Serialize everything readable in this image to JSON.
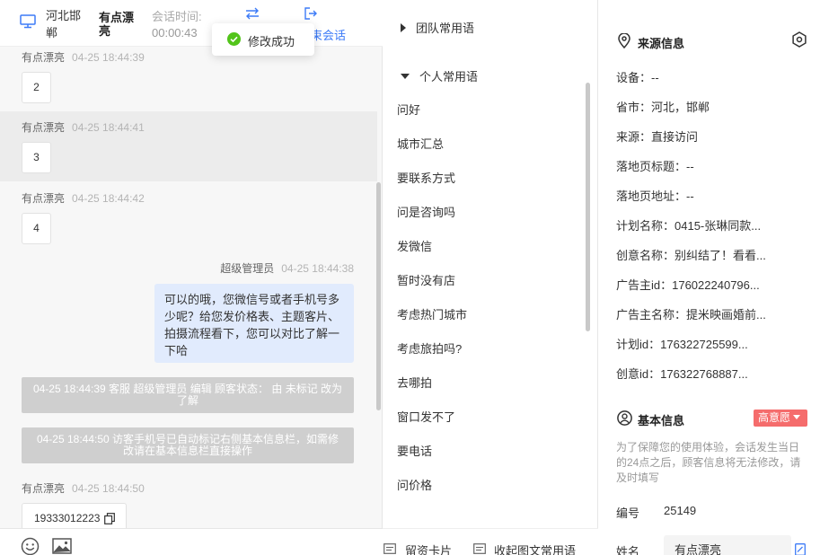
{
  "header": {
    "location": "河北邯郸",
    "visitor_name": "有点漂亮",
    "session_time_label": "会话时间:",
    "session_time_value": "00:00:43",
    "end_session_label": "束会话"
  },
  "toast": {
    "text": "修改成功"
  },
  "messages": [
    {
      "sender": "有点漂亮",
      "time": "04-25 18:44:39",
      "text": "2"
    },
    {
      "sender": "有点漂亮",
      "time": "04-25 18:44:41",
      "text": "3"
    },
    {
      "sender": "有点漂亮",
      "time": "04-25 18:44:42",
      "text": "4"
    },
    {
      "sender": "超级管理员",
      "time": "04-25 18:44:38",
      "text": "可以的哦，您微信号或者手机号多少呢？给您发价格表、主题客片、拍摄流程看下，您可以对比了解一下哈"
    },
    {
      "sender": "有点漂亮",
      "time": "04-25 18:44:50",
      "text": "19333012223"
    }
  ],
  "system_notices": [
    "04-25 18:44:39 客服 超级管理员 编辑 顾客状态： 由 未标记 改为 了解",
    "04-25 18:44:50 访客手机号已自动标记右侧基本信息栏，如需修改请在基本信息栏直接操作"
  ],
  "phrases": {
    "team_group": "团队常用语",
    "personal_group": "个人常用语",
    "items": [
      "问好",
      "城市汇总",
      "要联系方式",
      "问是咨询吗",
      "发微信",
      "暂时没有店",
      "考虑热门城市",
      "考虑旅拍吗?",
      "去哪拍",
      "窗口发不了",
      "要电话",
      "问价格"
    ],
    "footer_card": "留资卡片",
    "footer_collapse": "收起图文常用语"
  },
  "source_info": {
    "title": "来源信息",
    "rows": [
      "设备：--",
      "省市：河北，邯郸",
      "来源：直接访问",
      "落地页标题：--",
      "落地页地址：--",
      "计划名称：0415-张琳同款...",
      "创意名称：别纠结了！看看...",
      "广告主id：176022240796...",
      "广告主名称：提米映画婚前...",
      "计划id：176322725599...",
      "创意id：176322768887..."
    ]
  },
  "basic_info": {
    "title": "基本信息",
    "intent_badge": "高意愿",
    "note": "为了保障您的使用体验，会话发生当日的24点之后，顾客信息将无法修改，请及时填写",
    "id_label": "编号",
    "id_value": "25149",
    "name_label": "姓名",
    "name_value": "有点漂亮"
  },
  "colors": {
    "accent": "#3d7bf7",
    "agent_bubble": "#e1ebfd",
    "system_notice": "#cfcfcf",
    "intent_badge": "#f56c6c",
    "toast_success": "#52c41a"
  }
}
